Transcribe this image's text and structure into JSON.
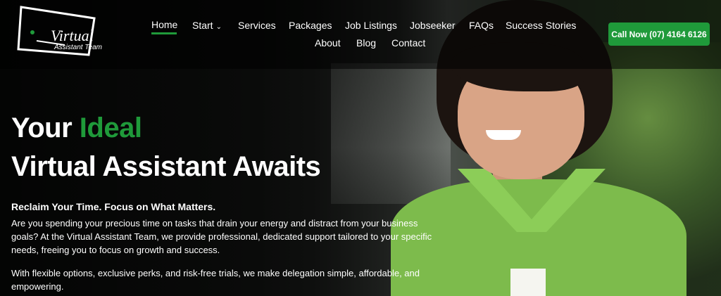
{
  "brand": {
    "logo_title": "Virtual",
    "logo_subtitle": "Assistant Team",
    "accent_color": "#1f9a3a"
  },
  "nav": {
    "row1": [
      {
        "label": "Home",
        "active": true
      },
      {
        "label": "Start",
        "has_dropdown": true
      },
      {
        "label": "Services"
      },
      {
        "label": "Packages"
      },
      {
        "label": "Job Listings"
      },
      {
        "label": "Jobseeker"
      },
      {
        "label": "FAQs"
      },
      {
        "label": "Success Stories"
      }
    ],
    "row2": [
      {
        "label": "About"
      },
      {
        "label": "Blog"
      },
      {
        "label": "Contact"
      }
    ],
    "cta_label": "Call Now (07) 4164 6126"
  },
  "hero": {
    "headline_prefix": "Your",
    "headline_accent": "Ideal",
    "headline_line2": "Virtual Assistant Awaits",
    "subheadline": "Reclaim Your Time. Focus on What Matters.",
    "paragraph1": "Are you spending your precious time on tasks that drain your energy and distract from your business goals? At the Virtual Assistant Team, we provide professional, dedicated support tailored to your specific needs, freeing you to focus on growth and success.",
    "paragraph2": "With flexible options, exclusive perks, and risk-free trials, we make delegation simple, affordable, and empowering."
  },
  "icons": {
    "dropdown": "chevron-down-icon",
    "logo": "monitor-logo-icon"
  }
}
